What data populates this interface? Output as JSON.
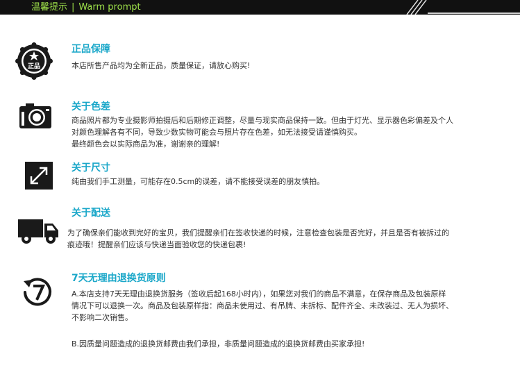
{
  "header": {
    "title_cn": "温馨提示",
    "separator": "|",
    "title_en": "Warm prompt"
  },
  "colors": {
    "accent_title": "#1aa7c9",
    "header_bg": "#111111",
    "header_text": "#9ee14a",
    "icon_dark": "#1a1a1a"
  },
  "sections": [
    {
      "icon": "genuine-seal-icon",
      "icon_text": "正品",
      "title": "正品保障",
      "lines": [
        "本店所售产品均为全新正品，质量保证，请放心购买!"
      ]
    },
    {
      "icon": "camera-icon",
      "title": "关于色差",
      "lines": [
        "商品照片都为专业摄影师拍摄后和后期修正调整，尽量与现实商品保持一致。但由于灯光、显示器色彩偏差及个人",
        "对颜色理解各有不同，导致少数实物可能会与照片存在色差，如无法接受请谨慎购买。",
        "最终颜色会以实际商品为准，谢谢亲的理解!"
      ]
    },
    {
      "icon": "resize-arrow-icon",
      "title": "关于尺寸",
      "lines": [
        "纯由我们手工测量，可能存在0.5cm的误差，请不能接受误差的朋友慎拍。"
      ]
    },
    {
      "icon": "truck-icon",
      "title": "关于配送",
      "lines": [
        "为了确保亲们能收到完好的宝贝，我们提醒亲们在签收快递的时候，注意检查包装是否完好，并且是否有被拆过的",
        "痕迹哦！提醒亲们应该与快递当面验收您的快递包裹!"
      ]
    },
    {
      "icon": "seven-day-return-icon",
      "title": "7天无理由退换货原则",
      "lines": [
        "A.本店支持7天无理由退换货服务（签收后起168小时内），如果您对我们的商品不满意，在保存商品及包装原样",
        "情况下可以退换一次。商品及包装原样指：商品未使用过、有吊牌、未拆标、配件齐全、未改装过、无人为损坏、",
        "不影响二次销售。"
      ],
      "extra": "B.因质量问题造成的退换货邮费由我们承担，非质量问题造成的退换货邮费由买家承担!"
    }
  ]
}
